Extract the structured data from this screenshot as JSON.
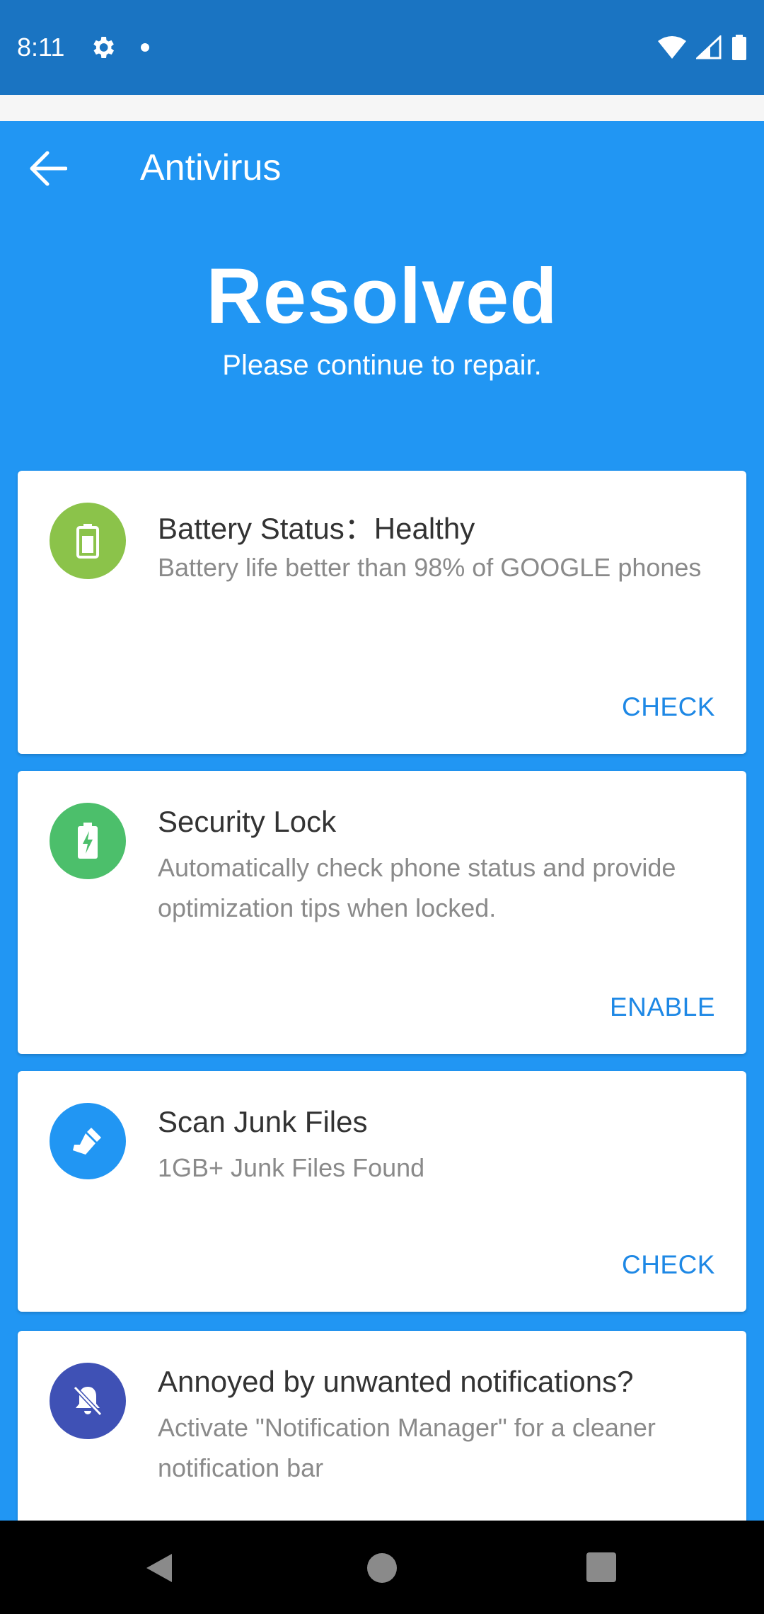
{
  "status_bar": {
    "time": "8:11",
    "icons": [
      "gear-icon",
      "dot-icon",
      "wifi-icon",
      "signal-icon",
      "battery-icon"
    ]
  },
  "toolbar": {
    "title": "Antivirus",
    "back_icon": "arrow-left-icon"
  },
  "hero": {
    "title": "Resolved",
    "subtitle": "Please continue to repair."
  },
  "cards": [
    {
      "title": "Battery Status：Healthy",
      "description": "Battery life better than 98% of GOOGLE phones",
      "action": "CHECK",
      "icon": "battery-icon",
      "icon_color": "#8bc34a"
    },
    {
      "title": "Security Lock",
      "description": "Automatically check phone status and provide optimization tips when locked.",
      "action": "ENABLE",
      "icon": "charging-battery-icon",
      "icon_color": "#4cbf6b"
    },
    {
      "title": "Scan Junk Files",
      "description": "1GB+ Junk Files Found",
      "action": "CHECK",
      "icon": "broom-icon",
      "icon_color": "#2196f3"
    },
    {
      "title": "Annoyed by unwanted notifications?",
      "description": "Activate \"Notification Manager\" for a cleaner notification bar",
      "action": "",
      "icon": "notifications-off-icon",
      "icon_color": "#3f51b5"
    }
  ],
  "colors": {
    "primary": "#2196f3",
    "status_bar": "#1a74c2",
    "accent_text": "#1e88e5"
  },
  "nav_bar": {
    "icons": [
      "nav-back-icon",
      "nav-home-icon",
      "nav-recents-icon"
    ]
  }
}
